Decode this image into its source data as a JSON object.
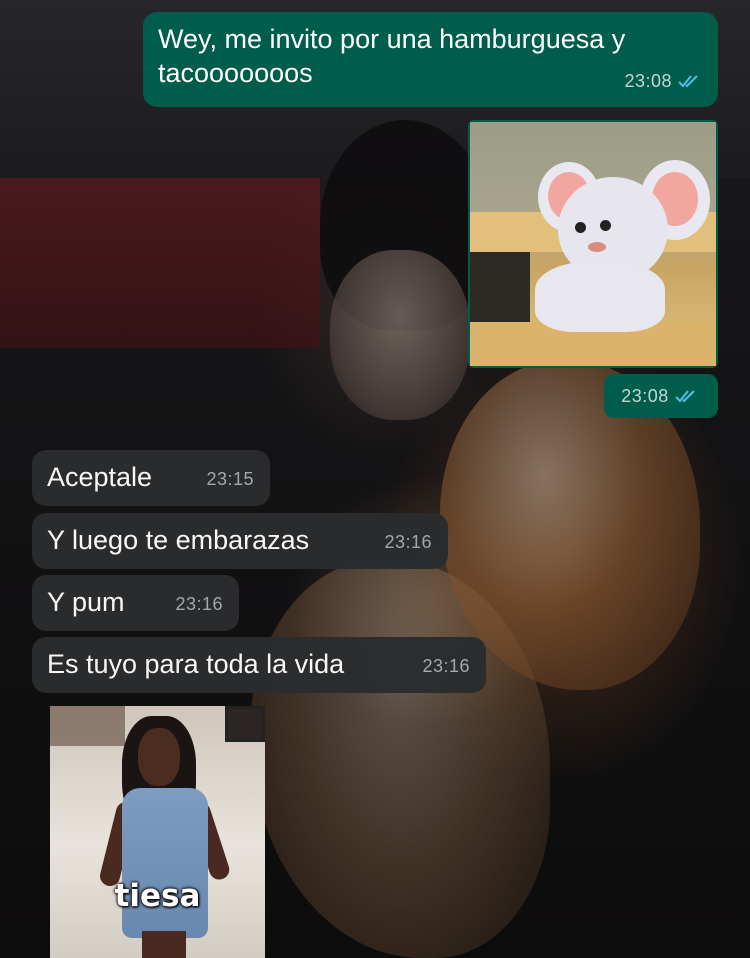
{
  "messages": [
    {
      "id": "m1",
      "direction": "outgoing",
      "type": "text",
      "text": "Wey, me invito por una hamburguesa y tacooooooos",
      "time": "23:08",
      "status": "read"
    },
    {
      "id": "m2",
      "direction": "outgoing",
      "type": "image",
      "image_description_icon": "cartoon-mouse-image",
      "time": "23:08",
      "status": "read"
    },
    {
      "id": "m3",
      "direction": "incoming",
      "type": "text",
      "text": "Aceptale",
      "time": "23:15"
    },
    {
      "id": "m4",
      "direction": "incoming",
      "type": "text",
      "text": "Y luego te embarazas",
      "time": "23:16"
    },
    {
      "id": "m5",
      "direction": "incoming",
      "type": "text",
      "text": "Y pum",
      "time": "23:16"
    },
    {
      "id": "m6",
      "direction": "incoming",
      "type": "text",
      "text": "Es tuyo para toda la vida",
      "time": "23:16"
    },
    {
      "id": "m7",
      "direction": "incoming",
      "type": "image",
      "caption": "tiesa"
    }
  ],
  "colors": {
    "outgoing_bubble": "#005c4b",
    "incoming_bubble": "#2a2c2e",
    "read_ticks": "#53bdeb"
  }
}
